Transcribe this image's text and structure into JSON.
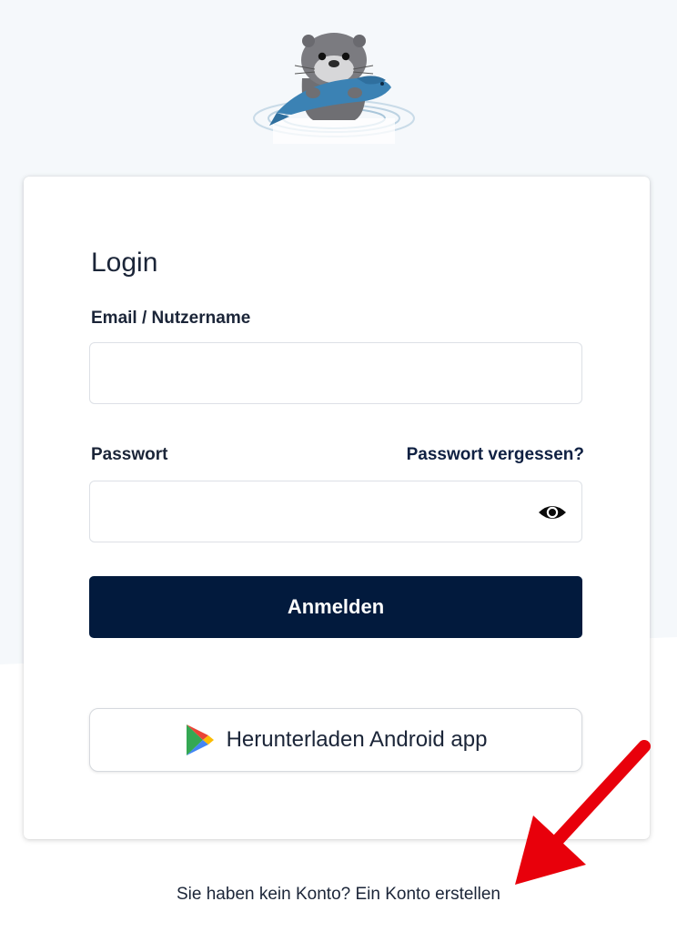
{
  "logo": {
    "icon": "otter-holding-fish-icon"
  },
  "login": {
    "title": "Login",
    "email_label": "Email / Nutzername",
    "email_value": "",
    "email_placeholder": "",
    "password_label": "Passwort",
    "password_value": "",
    "password_placeholder": "",
    "forgot_link": "Passwort vergessen?",
    "toggle_visibility_icon": "eye-icon",
    "submit_label": "Anmelden",
    "android_label": "Herunterladen Android app",
    "android_icon": "google-play-icon"
  },
  "footer": {
    "signup_prompt": "Sie haben kein Konto?",
    "signup_link": "Ein Konto erstellen"
  },
  "annotation": {
    "icon": "red-arrow-icon",
    "color": "#e8000b"
  },
  "colors": {
    "primary_button": "#021a3d",
    "text": "#1b2538",
    "background_tint": "#f4f7fb"
  }
}
